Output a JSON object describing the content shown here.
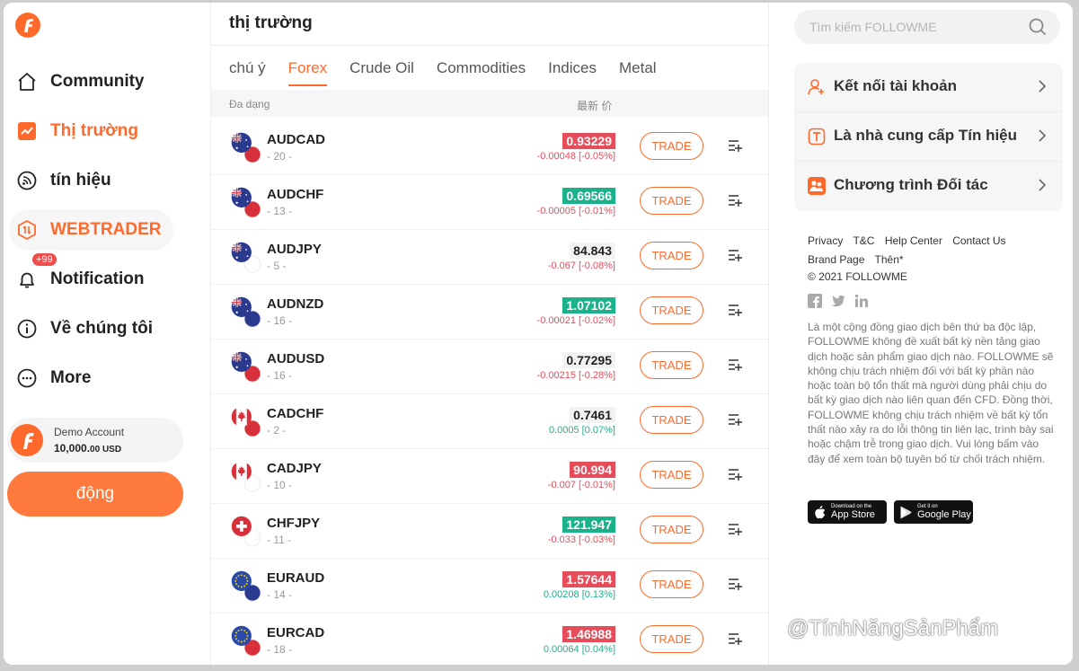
{
  "sidebar": {
    "items": [
      {
        "label": "Community",
        "icon": "home-icon"
      },
      {
        "label": "Thị trường",
        "icon": "chart-icon"
      },
      {
        "label": "tín hiệu",
        "icon": "signal-icon"
      },
      {
        "label": "WEBTRADER",
        "icon": "webtrader-icon"
      },
      {
        "label": "Notification",
        "icon": "bell-icon",
        "badge": "+99"
      },
      {
        "label": "Về chúng tôi",
        "icon": "info-icon"
      },
      {
        "label": "More",
        "icon": "more-icon"
      }
    ],
    "demo_title": "Demo Account",
    "demo_balance": "10,000.",
    "demo_cents": "00 USD",
    "activate_label": "động"
  },
  "main": {
    "title": "thị trường",
    "tabs": [
      "chú ý",
      "Forex",
      "Crude Oil",
      "Commodities",
      "Indices",
      "Metal"
    ],
    "active_tab": "Forex",
    "col_symbol": "Đa dạng",
    "col_price": "最新 价",
    "trade_label": "TRADE",
    "rows": [
      {
        "symbol": "AUDCAD",
        "count": "- 20 -",
        "price": "0.93229",
        "state": "down",
        "change": "-0.00048 [-0.05%]",
        "dir": "neg",
        "flag": "au"
      },
      {
        "symbol": "AUDCHF",
        "count": "- 13 -",
        "price": "0.69566",
        "state": "up",
        "change": "-0.00005 [-0.01%]",
        "dir": "neg",
        "flag": "au"
      },
      {
        "symbol": "AUDJPY",
        "count": "- 5 -",
        "price": "84.843",
        "state": "flat",
        "change": "-0.067 [-0.08%]",
        "dir": "neg",
        "flag": "au"
      },
      {
        "symbol": "AUDNZD",
        "count": "- 16 -",
        "price": "1.07102",
        "state": "up",
        "change": "-0.00021 [-0.02%]",
        "dir": "neg",
        "flag": "au"
      },
      {
        "symbol": "AUDUSD",
        "count": "- 16 -",
        "price": "0.77295",
        "state": "flat",
        "change": "-0.00215 [-0.28%]",
        "dir": "neg",
        "flag": "au"
      },
      {
        "symbol": "CADCHF",
        "count": "- 2 -",
        "price": "0.7461",
        "state": "flat",
        "change": "0.0005 [0.07%]",
        "dir": "pos",
        "flag": "ca"
      },
      {
        "symbol": "CADJPY",
        "count": "- 10 -",
        "price": "90.994",
        "state": "down",
        "change": "-0.007 [-0.01%]",
        "dir": "neg",
        "flag": "ca"
      },
      {
        "symbol": "CHFJPY",
        "count": "- 11 -",
        "price": "121.947",
        "state": "up",
        "change": "-0.033 [-0.03%]",
        "dir": "neg",
        "flag": "ch"
      },
      {
        "symbol": "EURAUD",
        "count": "- 14 -",
        "price": "1.57644",
        "state": "down",
        "change": "0.00208 [0.13%]",
        "dir": "pos",
        "flag": "eu"
      },
      {
        "symbol": "EURCAD",
        "count": "- 18 -",
        "price": "1.46988",
        "state": "down",
        "change": "0.00064 [0.04%]",
        "dir": "pos",
        "flag": "eu"
      }
    ]
  },
  "right": {
    "search_placeholder": "Tìm kiếm FOLLOWME",
    "links": [
      {
        "label": "Kết nối tài khoản",
        "icon": "user-add-icon"
      },
      {
        "label": "Là nhà cung cấp Tín hiệu",
        "icon": "signal-provider-icon"
      },
      {
        "label": "Chương trình Đối tác",
        "icon": "partners-icon"
      }
    ],
    "footer_links": [
      "Privacy",
      "T&C",
      "Help Center",
      "Contact Us",
      "Brand Page",
      "Thên*"
    ],
    "copyright": "© 2021 FOLLOWME",
    "disclaimer": "Là một cộng đồng giao dịch bên thứ ba độc lập, FOLLOWME không đề xuất bất kỳ nền tảng giao dịch hoặc sản phẩm giao dịch nào. FOLLOWME sẽ không chịu trách nhiệm đối với bất kỳ phần nào hoặc toàn bộ tổn thất mà người dùng phải chịu do bất kỳ giao dịch nào liên quan đến CFD. Đồng thời, FOLLOWME không chịu trách nhiệm về bất kỳ tổn thất nào xảy ra do lỗi thông tin liên lạc, trình bày sai hoặc chậm trễ trong giao dịch. Vui lòng bấm vào đây để xem toàn bộ tuyên bố từ chối trách nhiệm.",
    "appstore_small": "Download on the",
    "appstore_big": "App Store",
    "googleplay_small": "Get it on",
    "googleplay_big": "Google Play"
  },
  "watermark": "@TínhNăngSảnPhẩm",
  "colors": {
    "accent": "#ff6a2c",
    "up": "#19b28a",
    "down": "#e54d5a"
  }
}
